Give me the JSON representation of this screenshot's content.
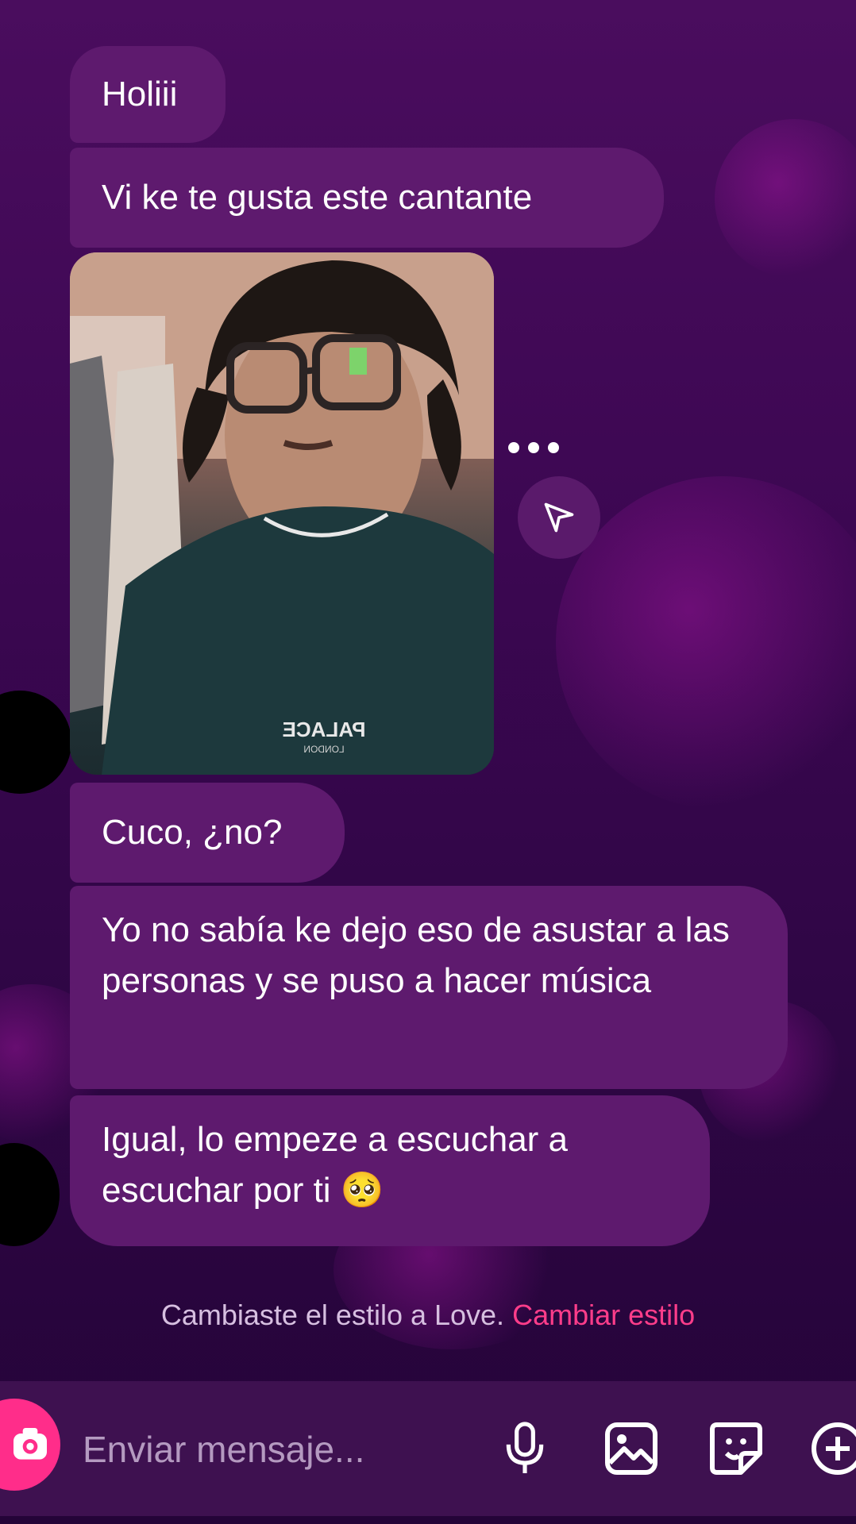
{
  "messages": [
    {
      "text": "Holiii"
    },
    {
      "text": "Vi ke te gusta este cantante"
    },
    {
      "text": "Cuco, ¿no?"
    },
    {
      "text": "Yo no sabía ke dejo eso de asustar a las personas y se puso a hacer música"
    },
    {
      "text": "Igual, lo empeze a escuchar a escuchar por ti 🥺"
    }
  ],
  "photo": {
    "shirt_text": "PALACE",
    "shirt_subtext": "LONDON"
  },
  "notice": {
    "text": "Cambiaste el estilo a Love.",
    "link": "Cambiar estilo"
  },
  "composer": {
    "placeholder": "Enviar mensaje..."
  },
  "icons": {
    "more": "more-dots-icon",
    "share": "send-arrow-icon",
    "camera": "camera-icon",
    "mic": "microphone-icon",
    "gallery": "image-gallery-icon",
    "sticker": "sticker-icon",
    "add": "plus-icon"
  },
  "colors": {
    "bubble": "#5e1a6e",
    "accent": "#ff2d8a",
    "link": "#ff3d8a",
    "background": "#3c0752"
  }
}
